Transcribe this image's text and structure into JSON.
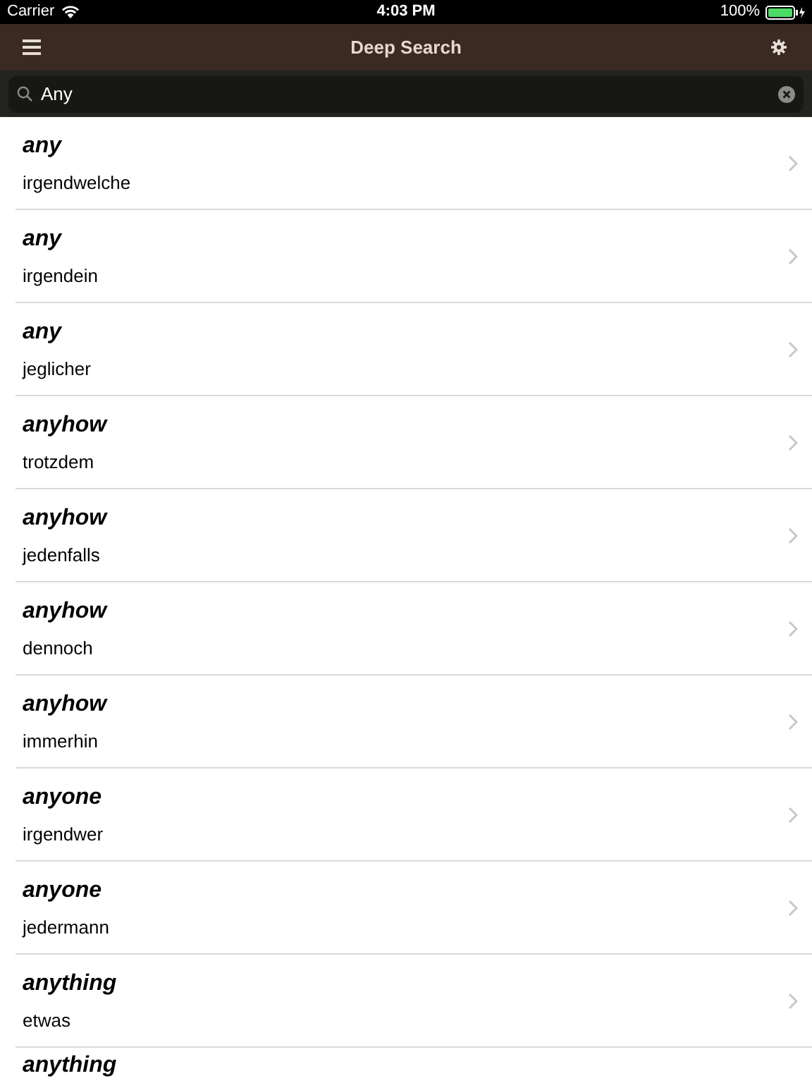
{
  "status_bar": {
    "carrier": "Carrier",
    "time": "4:03 PM",
    "battery": "100%"
  },
  "nav": {
    "title": "Deep Search"
  },
  "search": {
    "value": "Any"
  },
  "results": [
    {
      "term": "any",
      "translation": "irgendwelche"
    },
    {
      "term": "any",
      "translation": "irgendein"
    },
    {
      "term": "any",
      "translation": "jeglicher"
    },
    {
      "term": "anyhow",
      "translation": "trotzdem"
    },
    {
      "term": "anyhow",
      "translation": "jedenfalls"
    },
    {
      "term": "anyhow",
      "translation": "dennoch"
    },
    {
      "term": "anyhow",
      "translation": "immerhin"
    },
    {
      "term": "anyone",
      "translation": "irgendwer"
    },
    {
      "term": "anyone",
      "translation": "jedermann"
    },
    {
      "term": "anything",
      "translation": "etwas"
    },
    {
      "term": "anything"
    }
  ]
}
